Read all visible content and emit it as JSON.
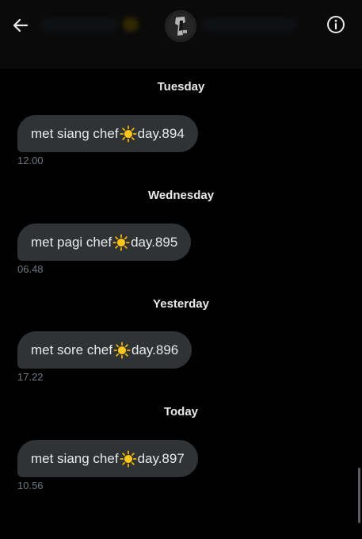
{
  "header": {
    "back_icon": "arrow-left-icon",
    "avatar_icon": "profile-avatar",
    "info_icon": "info-icon"
  },
  "messages": [
    {
      "day": "Tuesday",
      "pre": "met siang chef",
      "emoji": "sun-icon",
      "post": "day.894",
      "time": "12.00"
    },
    {
      "day": "Wednesday",
      "pre": "met pagi chef",
      "emoji": "sun-icon",
      "post": "day.895",
      "time": "06.48"
    },
    {
      "day": "Yesterday",
      "pre": "met sore chef",
      "emoji": "sun-icon",
      "post": "day.896",
      "time": "17.22"
    },
    {
      "day": "Today",
      "pre": "met siang chef",
      "emoji": "sun-icon",
      "post": "day.897",
      "time": "10.56"
    }
  ],
  "colors": {
    "background": "#000000",
    "bubble": "#2f3336",
    "text": "#e7e9ea",
    "muted": "#71767b"
  }
}
